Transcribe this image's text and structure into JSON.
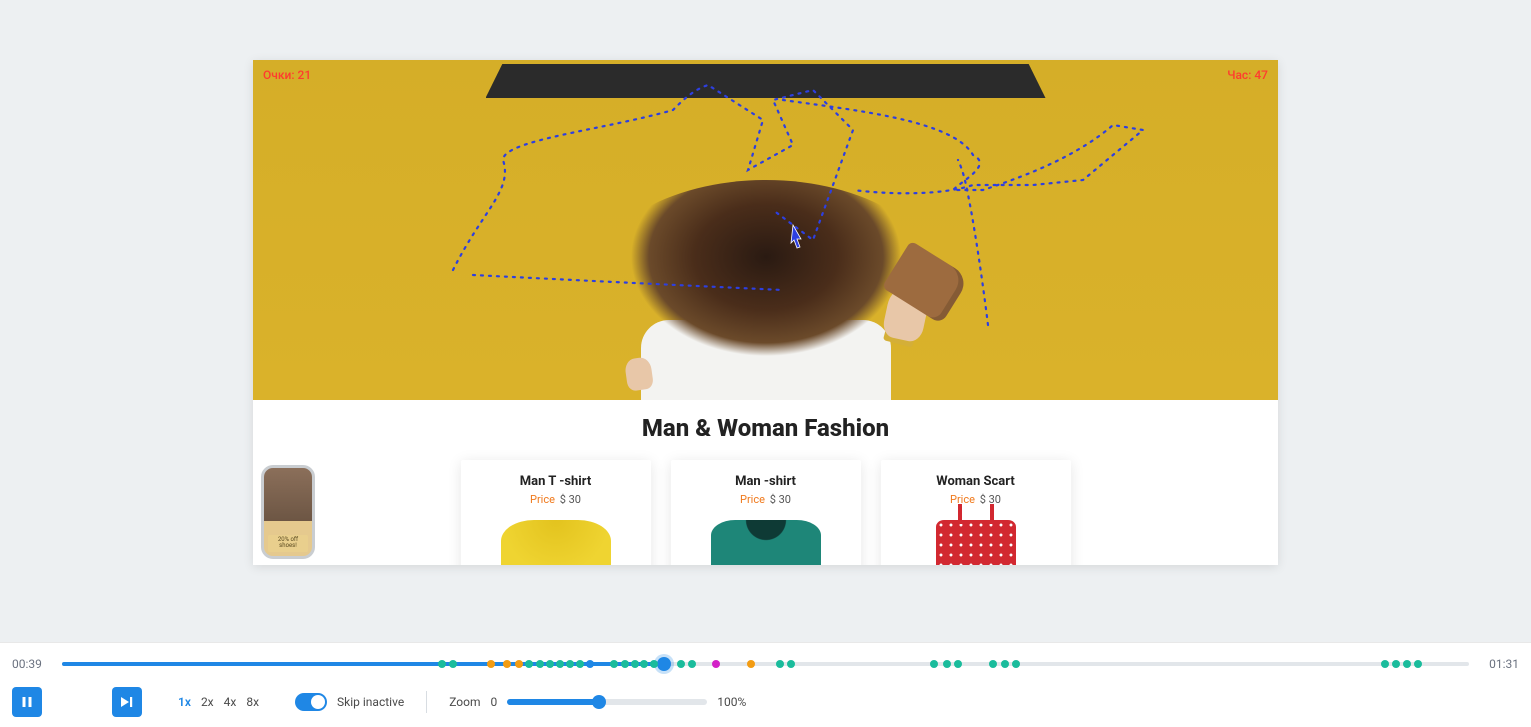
{
  "overlay": {
    "left_label": "Очки: 21",
    "right_label": "Час: 47"
  },
  "hero": {
    "section_title": "Man & Woman Fashion"
  },
  "products": [
    {
      "title": "Man T -shirt",
      "price_label": "Price",
      "price": "$ 30"
    },
    {
      "title": "Man -shirt",
      "price_label": "Price",
      "price": "$ 30"
    },
    {
      "title": "Woman Scart",
      "price_label": "Price",
      "price": "$ 30"
    }
  ],
  "thumb": {
    "badge_line1": "20% off",
    "badge_line2": "shoes!"
  },
  "player": {
    "current_time": "00:39",
    "total_time": "01:31",
    "progress_pct": 42.8,
    "speeds": [
      "1x",
      "2x",
      "4x",
      "8x"
    ],
    "active_speed": "1x",
    "skip_inactive_label": "Skip inactive",
    "skip_inactive_on": true,
    "zoom_label": "Zoom",
    "zoom_min": "0",
    "zoom_max": "100%",
    "zoom_pct": 46
  },
  "events": [
    {
      "pos": 27.0,
      "c": "teal"
    },
    {
      "pos": 27.8,
      "c": "teal"
    },
    {
      "pos": 30.5,
      "c": "orange"
    },
    {
      "pos": 31.6,
      "c": "orange"
    },
    {
      "pos": 32.5,
      "c": "orange"
    },
    {
      "pos": 33.2,
      "c": "teal"
    },
    {
      "pos": 34.0,
      "c": "teal"
    },
    {
      "pos": 34.7,
      "c": "teal"
    },
    {
      "pos": 35.4,
      "c": "teal"
    },
    {
      "pos": 36.1,
      "c": "teal"
    },
    {
      "pos": 36.8,
      "c": "teal"
    },
    {
      "pos": 37.5,
      "c": "blue"
    },
    {
      "pos": 39.2,
      "c": "teal"
    },
    {
      "pos": 40.0,
      "c": "teal"
    },
    {
      "pos": 40.7,
      "c": "teal"
    },
    {
      "pos": 41.4,
      "c": "teal"
    },
    {
      "pos": 42.1,
      "c": "teal"
    },
    {
      "pos": 44.0,
      "c": "teal"
    },
    {
      "pos": 44.8,
      "c": "teal"
    },
    {
      "pos": 46.5,
      "c": "magenta"
    },
    {
      "pos": 49.0,
      "c": "orange"
    },
    {
      "pos": 51.0,
      "c": "teal"
    },
    {
      "pos": 51.8,
      "c": "teal"
    },
    {
      "pos": 62.0,
      "c": "teal"
    },
    {
      "pos": 62.9,
      "c": "teal"
    },
    {
      "pos": 63.7,
      "c": "teal"
    },
    {
      "pos": 66.2,
      "c": "teal"
    },
    {
      "pos": 67.0,
      "c": "teal"
    },
    {
      "pos": 67.8,
      "c": "teal"
    },
    {
      "pos": 94.0,
      "c": "teal"
    },
    {
      "pos": 94.8,
      "c": "teal"
    },
    {
      "pos": 95.6,
      "c": "teal"
    },
    {
      "pos": 96.4,
      "c": "teal"
    }
  ],
  "colors": {
    "primary": "#1f87e5",
    "teal": "#1abc9c",
    "orange": "#f39c12",
    "magenta": "#d321c7"
  }
}
